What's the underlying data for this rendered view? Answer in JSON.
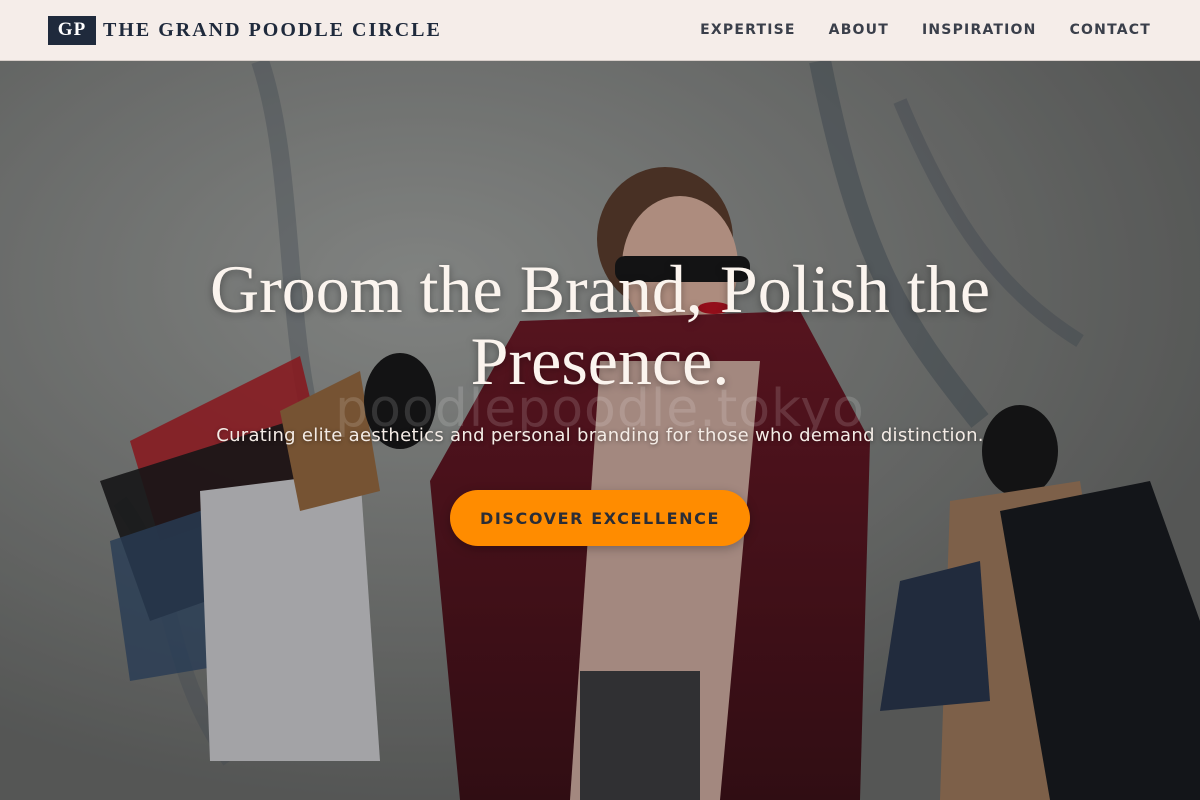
{
  "header": {
    "logo_monogram": "GP",
    "brand_name": "THE GRAND POODLE CIRCLE",
    "nav": [
      {
        "label": "EXPERTISE"
      },
      {
        "label": "ABOUT"
      },
      {
        "label": "INSPIRATION"
      },
      {
        "label": "CONTACT"
      }
    ]
  },
  "hero": {
    "title": "Groom the Brand, Polish the Presence.",
    "subtitle": "Curating elite aesthetics and personal branding for those who demand distinction.",
    "watermark": "poodlepoodle.tokyo",
    "cta_label": "DISCOVER EXCELLENCE",
    "background_image": "woman-with-shopping-bags-photo"
  },
  "colors": {
    "header_bg": "#f5ede9",
    "logo_bg": "#1f2a3c",
    "accent": "#ff8c00",
    "hero_text": "#fbf4ee"
  }
}
